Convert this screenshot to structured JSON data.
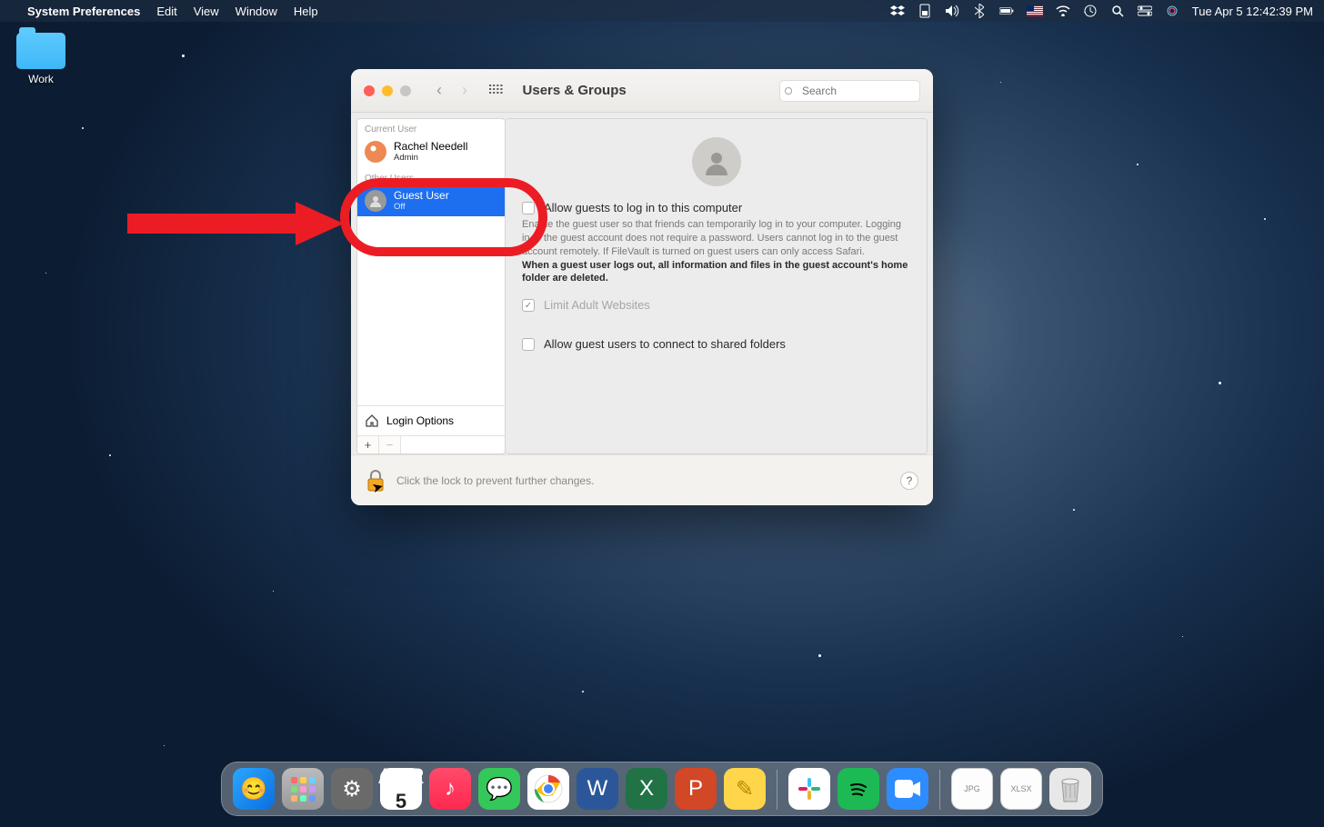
{
  "menubar": {
    "app_name": "System Preferences",
    "items": [
      "Edit",
      "View",
      "Window",
      "Help"
    ],
    "date_time": "Tue Apr 5  12:42:39 PM",
    "status_icons": [
      "dropbox",
      "battery-card",
      "volume",
      "bluetooth",
      "battery",
      "flag-us",
      "wifi",
      "time-machine",
      "spotlight",
      "control-center",
      "siri"
    ]
  },
  "desktop": {
    "folder_label": "Work"
  },
  "window": {
    "title": "Users & Groups",
    "search_placeholder": "Search",
    "sidebar": {
      "section_current": "Current User",
      "current_user": {
        "name": "Rachel Needell",
        "role": "Admin"
      },
      "section_other": "Other Users",
      "guest_user": {
        "name": "Guest User",
        "status": "Off"
      },
      "login_options": "Login Options"
    },
    "content": {
      "allow_login_label": "Allow guests to log in to this computer",
      "allow_login_desc": "Enable the guest user so that friends can temporarily log in to your computer. Logging in to the guest account does not require a password. Users cannot log in to the guest account remotely. If FileVault is turned on guest users can only access Safari.",
      "allow_login_desc_bold": "When a guest user logs out, all information and files in the guest account's home folder are deleted.",
      "limit_adult_label": "Limit Adult Websites",
      "shared_folders_label": "Allow guest users to connect to shared folders"
    },
    "footer": {
      "lock_text": "Click the lock to prevent further changes."
    }
  },
  "dock": {
    "cal_month": "APR",
    "cal_day": "5",
    "apps": [
      "Finder",
      "Launchpad",
      "System Preferences",
      "Calendar",
      "Music",
      "Messages",
      "Chrome",
      "Word",
      "Excel",
      "PowerPoint",
      "Notes",
      "Slack",
      "Spotify",
      "Zoom"
    ],
    "right": [
      "JPG file",
      "XLSX file",
      "Trash"
    ]
  }
}
